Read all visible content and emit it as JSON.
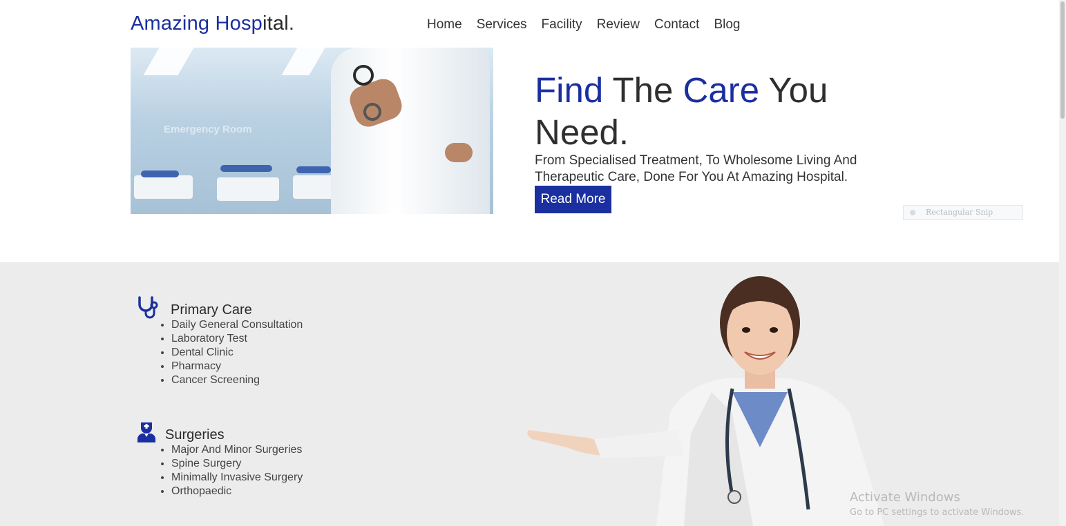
{
  "header": {
    "logo_part1": "Amazing",
    "logo_part2": " Hosp",
    "logo_part3": "ital."
  },
  "nav": {
    "items": [
      "Home",
      "Services",
      "Facility",
      "Review",
      "Contact",
      "Blog"
    ]
  },
  "hero": {
    "image_sign": "Emergency Room",
    "title_w1": "Find",
    "title_w2": " The ",
    "title_w3": "Care",
    "title_w4": " You Need.",
    "subtitle": "From Specialised Treatment, To Wholesome Living And Therapeutic Care, Done For You At Amazing Hospital.",
    "button": "Read More"
  },
  "snip_tool": {
    "label": "Rectangular Snip"
  },
  "services": [
    {
      "title": "Primary Care",
      "icon": "stethoscope-icon",
      "items": [
        "Daily General Consultation",
        "Laboratory Test",
        "Dental Clinic",
        "Pharmacy",
        "Cancer Screening"
      ]
    },
    {
      "title": "Surgeries",
      "icon": "nurse-icon",
      "items": [
        "Major And Minor Surgeries",
        "Spine Surgery",
        "Minimally Invasive Surgery",
        "Orthopaedic"
      ]
    }
  ],
  "windows_watermark": {
    "line1": "Activate Windows",
    "line2": "Go to PC settings to activate Windows."
  },
  "colors": {
    "brand_blue": "#1a2fa0",
    "band_bg": "#ececec"
  }
}
